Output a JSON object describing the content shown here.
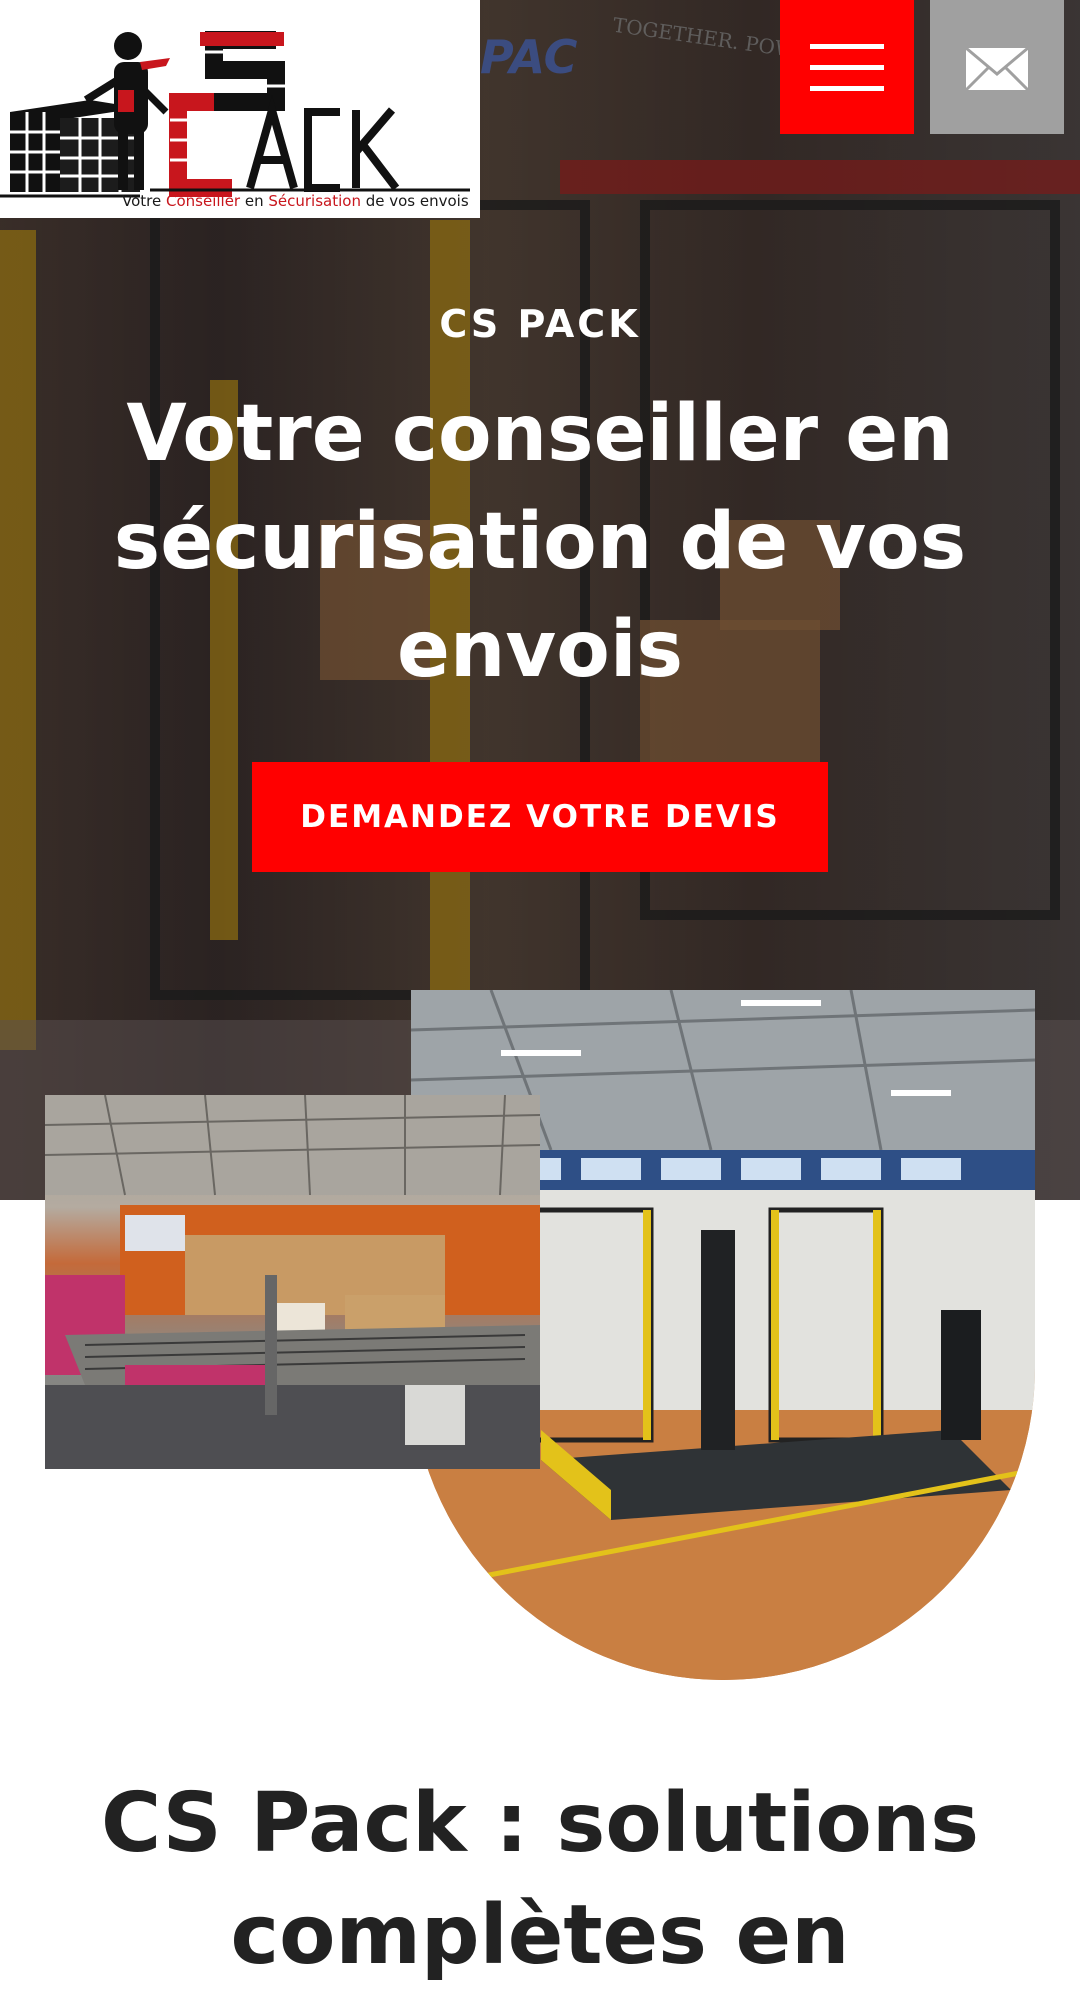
{
  "header": {
    "logo": {
      "icon": "cs-pack-logo",
      "tagline_pre": "Votre ",
      "tagline_red1": "Conseiller",
      "tagline_mid": " en ",
      "tagline_red2": "Sécurisation",
      "tagline_post": " de vos envois"
    },
    "menu_icon": "hamburger-menu-icon",
    "mail_icon": "envelope-icon"
  },
  "hero": {
    "eyebrow": "CS PACK",
    "title": "Votre conseiller en sécurisation de vos envois",
    "cta_label": "DEMANDEZ VOTRE DEVIS",
    "background_text": "TOGETHER. POWERI",
    "background_logo": "PAC"
  },
  "section": {
    "title_line1": "CS Pack : solutions",
    "title_line2": "complètes en"
  },
  "colors": {
    "accent": "#ff0000",
    "mail_button": "#a0a0a0",
    "logo_red": "#c8161d",
    "heading": "#222222"
  }
}
